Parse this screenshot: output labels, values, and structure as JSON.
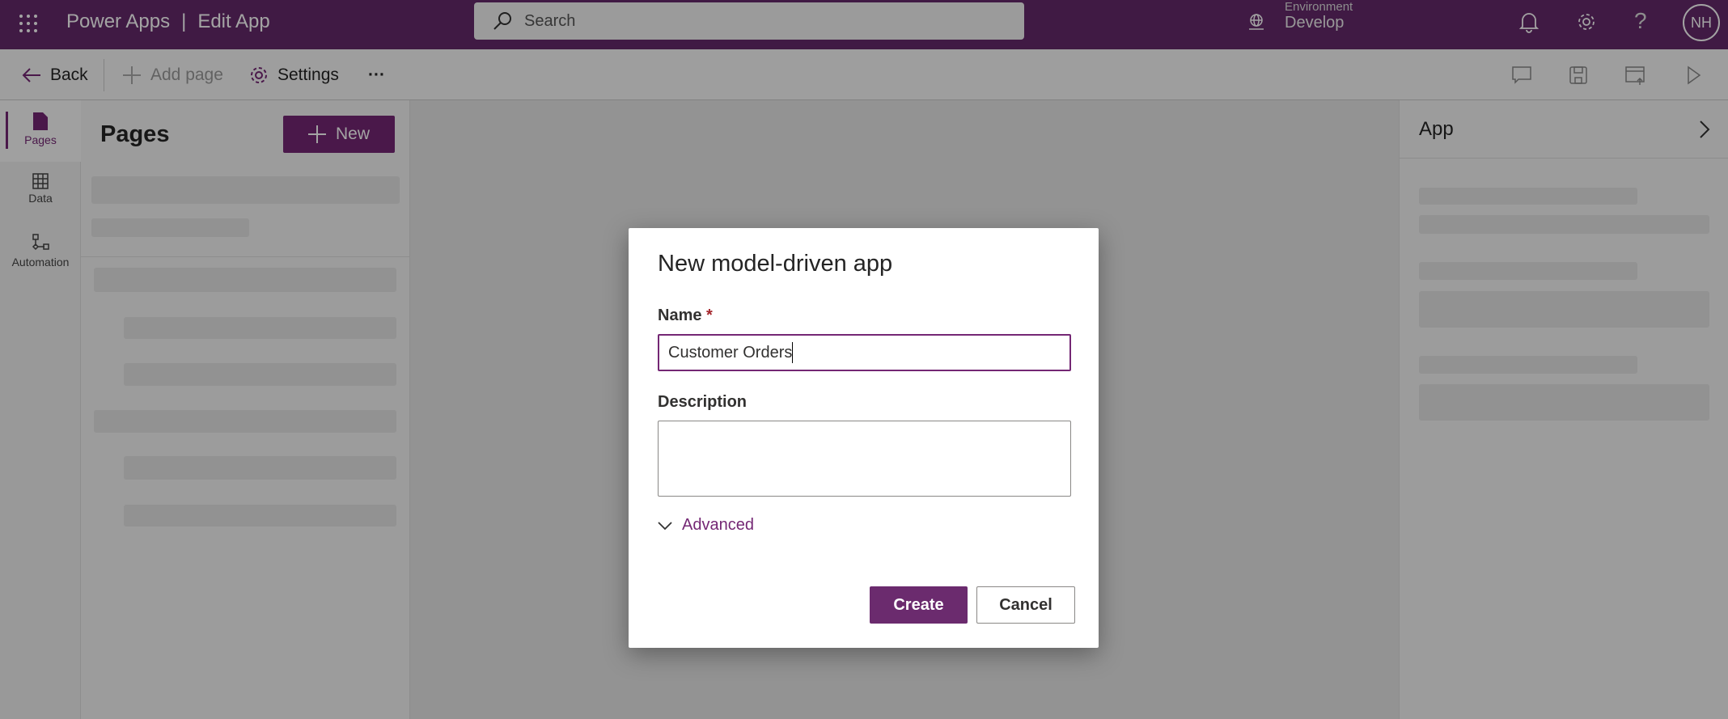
{
  "header": {
    "app_title": "Power Apps",
    "separator": "|",
    "page_title": "Edit App",
    "search_placeholder": "Search",
    "environment_label": "Environment",
    "environment_value": "Develop",
    "avatar_initials": "NH"
  },
  "toolbar": {
    "back": "Back",
    "add_page": "Add page",
    "settings": "Settings",
    "more": "···"
  },
  "rail": {
    "items": [
      {
        "label": "Pages"
      },
      {
        "label": "Data"
      },
      {
        "label": "Automation"
      }
    ]
  },
  "pages_panel": {
    "title": "Pages",
    "new_button": "New"
  },
  "right_panel": {
    "title": "App"
  },
  "dialog": {
    "title": "New model-driven app",
    "name_label": "Name",
    "required_mark": "*",
    "name_value": "Customer Orders",
    "description_label": "Description",
    "description_value": "",
    "advanced": "Advanced",
    "create": "Create",
    "cancel": "Cancel"
  },
  "colors": {
    "brand": "#742774",
    "required": "#a4262c"
  }
}
